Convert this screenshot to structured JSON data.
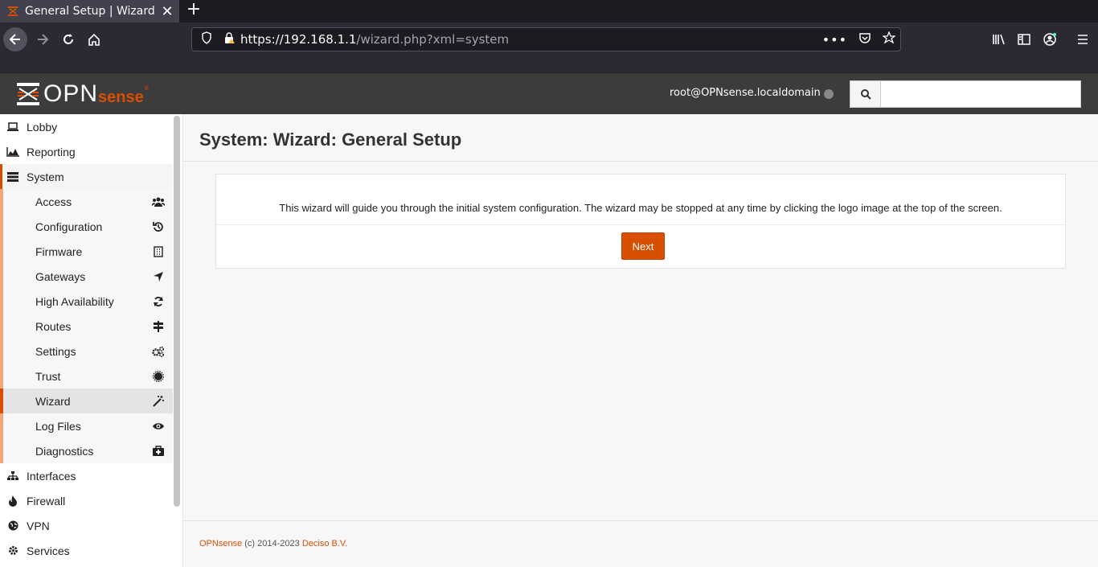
{
  "browser": {
    "tab_title": "General Setup | Wizard |",
    "url_host": "https://192.168.1.1",
    "url_path": "/wizard.php?xml=system"
  },
  "header": {
    "logo_main": "OPN",
    "logo_sense": "sense",
    "user": "root@OPNsense.localdomain",
    "search_placeholder": ""
  },
  "sidebar": {
    "top_items": [
      {
        "label": "Lobby",
        "icon": "laptop-icon"
      },
      {
        "label": "Reporting",
        "icon": "area-chart-icon"
      },
      {
        "label": "System",
        "icon": "server-icon"
      }
    ],
    "system_items": [
      {
        "label": "Access",
        "icon": "users-icon"
      },
      {
        "label": "Configuration",
        "icon": "history-icon"
      },
      {
        "label": "Firmware",
        "icon": "building-icon"
      },
      {
        "label": "Gateways",
        "icon": "location-arrow-icon"
      },
      {
        "label": "High Availability",
        "icon": "refresh-icon"
      },
      {
        "label": "Routes",
        "icon": "map-signs-icon"
      },
      {
        "label": "Settings",
        "icon": "cogs-icon"
      },
      {
        "label": "Trust",
        "icon": "certificate-icon"
      },
      {
        "label": "Wizard",
        "icon": "magic-icon"
      },
      {
        "label": "Log Files",
        "icon": "eye-icon"
      },
      {
        "label": "Diagnostics",
        "icon": "medkit-icon"
      }
    ],
    "bottom_items": [
      {
        "label": "Interfaces",
        "icon": "sitemap-icon"
      },
      {
        "label": "Firewall",
        "icon": "fire-icon"
      },
      {
        "label": "VPN",
        "icon": "globe-icon"
      },
      {
        "label": "Services",
        "icon": "cog-icon"
      }
    ]
  },
  "main": {
    "title": "System: Wizard: General Setup",
    "description": "This wizard will guide you through the initial system configuration. The wizard may be stopped at any time by clicking the logo image at the top of the screen.",
    "next_label": "Next"
  },
  "footer": {
    "brand": "OPNsense",
    "copyright": " (c) 2014-2023 ",
    "company": "Deciso B.V."
  },
  "colors": {
    "accent": "#d94f00",
    "header_bg": "#3c3c3c"
  }
}
